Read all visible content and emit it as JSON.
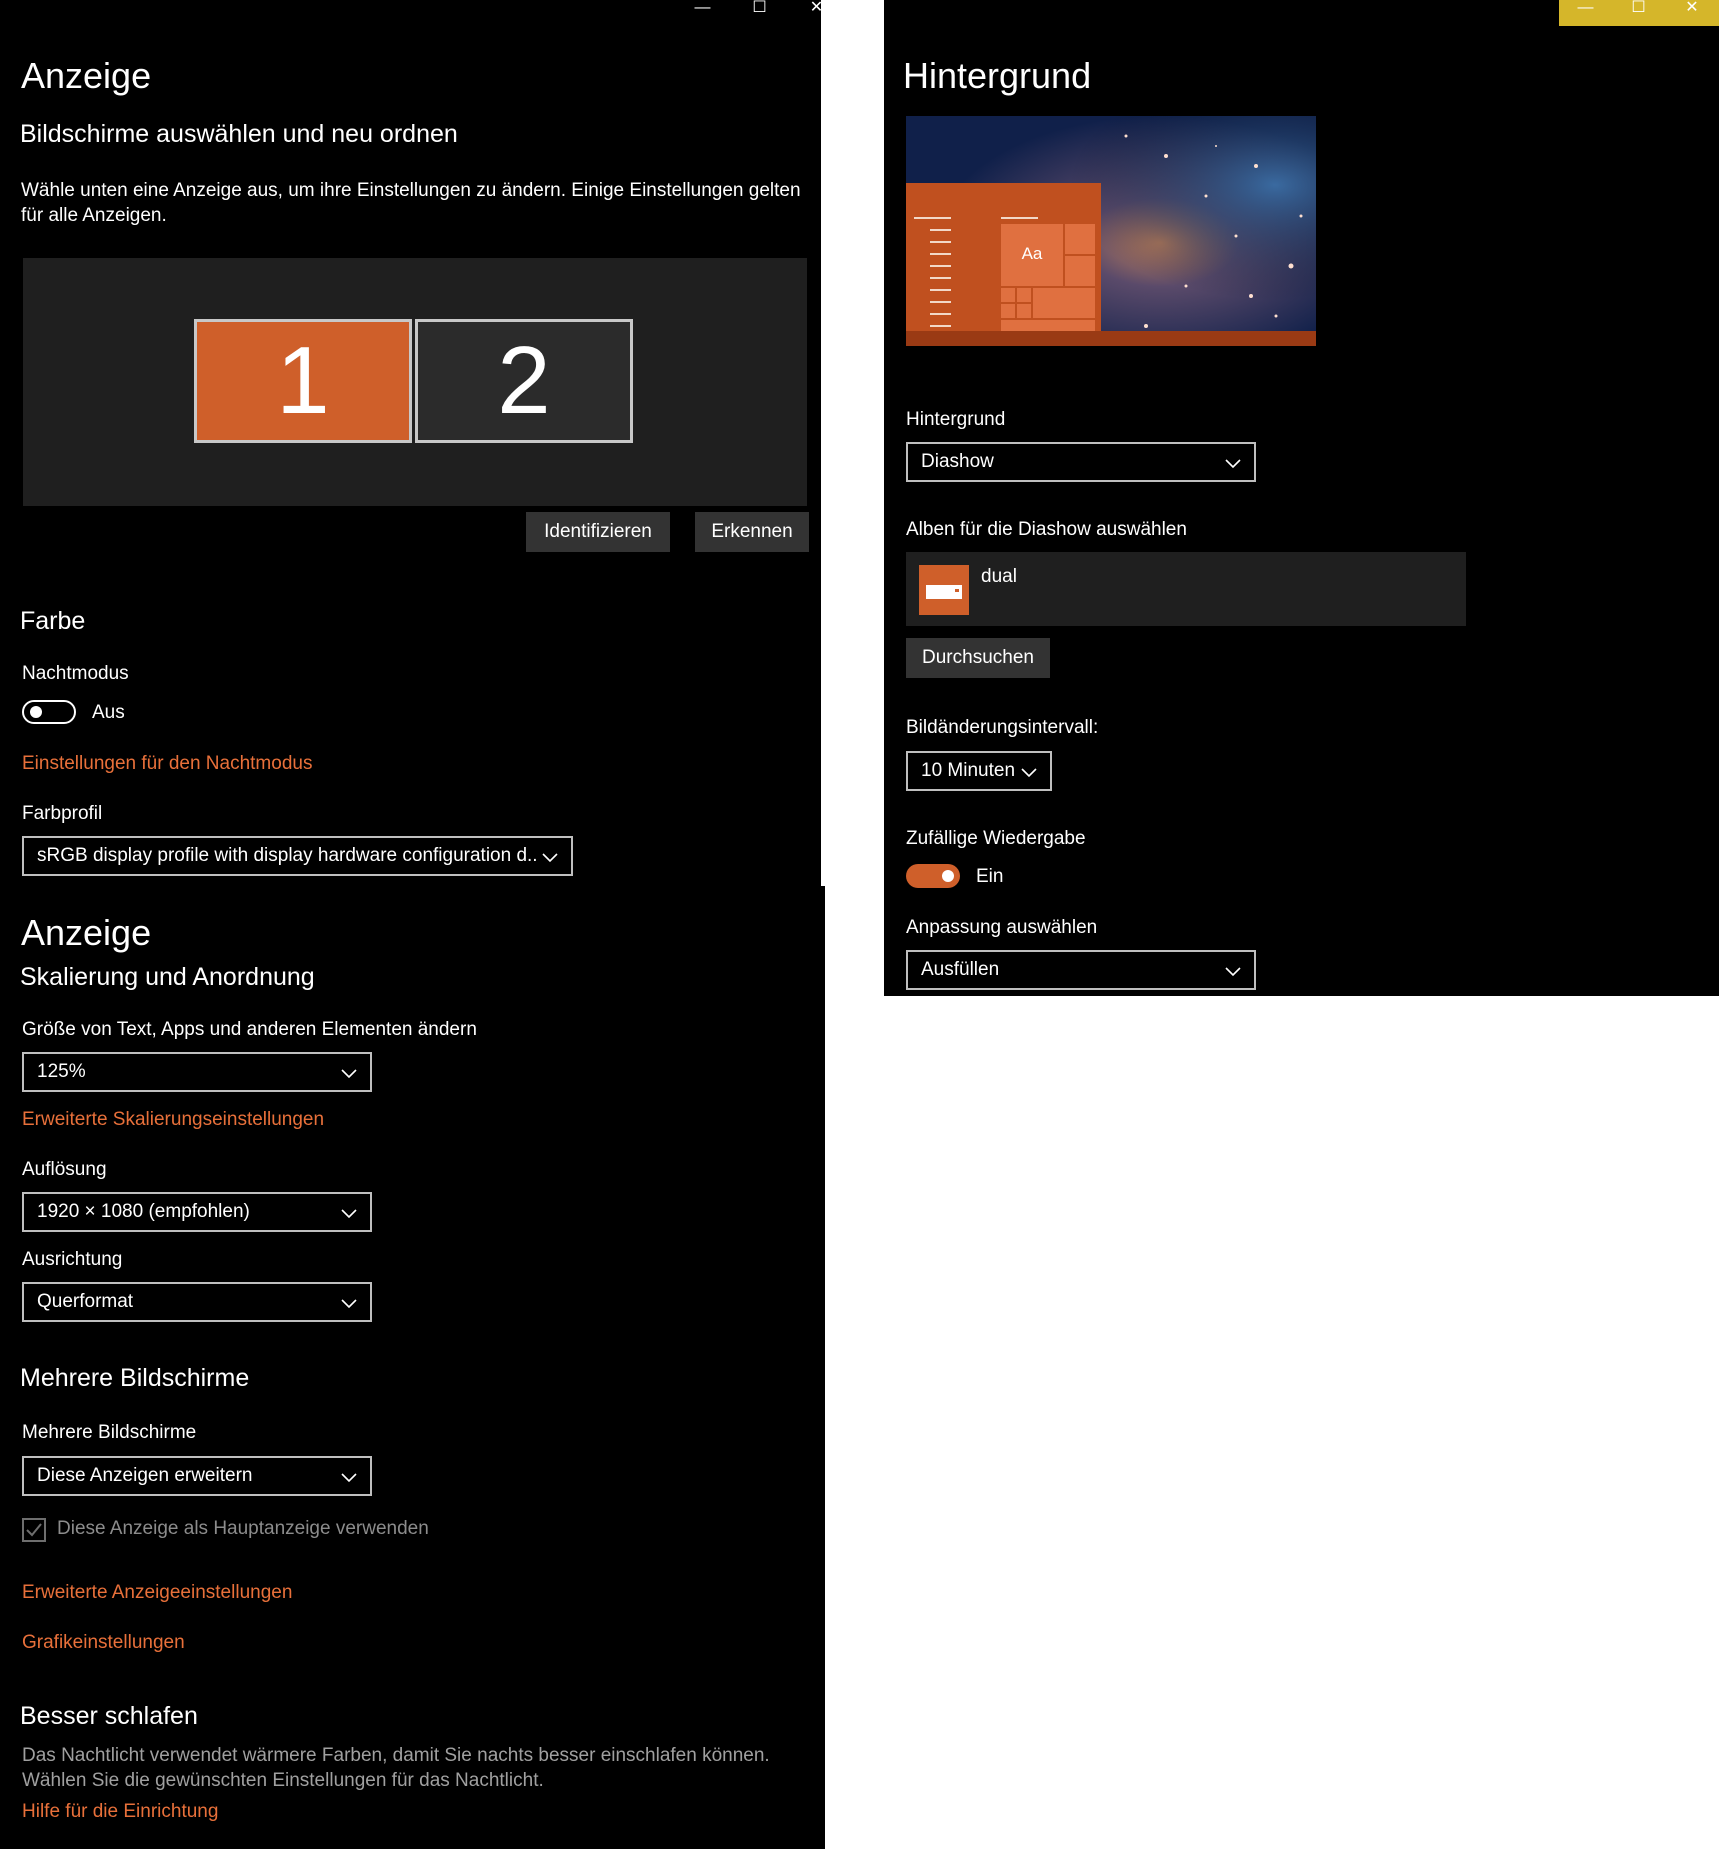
{
  "left_window": {
    "caption": {
      "minimize": "—",
      "maximize": "☐",
      "close": "✕"
    },
    "title": "Anzeige",
    "arrange": {
      "heading": "Bildschirme auswählen und neu ordnen",
      "description": "Wähle unten eine Anzeige aus, um ihre Einstellungen zu ändern. Einige Einstellungen gelten für alle Anzeigen.",
      "monitors": [
        {
          "label": "1",
          "selected": true
        },
        {
          "label": "2",
          "selected": false
        }
      ],
      "identify_label": "Identifizieren",
      "detect_label": "Erkennen"
    },
    "color": {
      "heading": "Farbe",
      "night_mode_label": "Nachtmodus",
      "night_mode_state": "Aus",
      "night_mode_settings_link": "Einstellungen für den Nachtmodus",
      "color_profile_label": "Farbprofil",
      "color_profile_value": "sRGB display profile with display hardware configuration d..."
    },
    "scale": {
      "title": "Anzeige",
      "heading": "Skalierung und Anordnung",
      "size_label": "Größe von Text, Apps und anderen Elementen ändern",
      "size_value": "125%",
      "advanced_scaling_link": "Erweiterte Skalierungseinstellungen",
      "resolution_label": "Auflösung",
      "resolution_value": "1920 × 1080 (empfohlen)",
      "orientation_label": "Ausrichtung",
      "orientation_value": "Querformat"
    },
    "multi": {
      "heading": "Mehrere Bildschirme",
      "label": "Mehrere Bildschirme",
      "value": "Diese Anzeigen erweitern",
      "main_display_checkbox": "Diese Anzeige als Hauptanzeige verwenden",
      "advanced_display_link": "Erweiterte Anzeigeeinstellungen",
      "graphics_link": "Grafikeinstellungen"
    },
    "sleep": {
      "heading": "Besser schlafen",
      "text": "Das Nachtlicht verwendet wärmere Farben, damit Sie nachts besser einschlafen können. Wählen Sie die gewünschten Einstellungen für das Nachtlicht.",
      "help_link": "Hilfe für die Einrichtung"
    }
  },
  "right_window": {
    "caption": {
      "minimize": "—",
      "maximize": "☐",
      "close": "✕"
    },
    "caption_color": "#d5b62a",
    "title": "Hintergrund",
    "preview_tile_text": "Aa",
    "background_label": "Hintergrund",
    "background_value": "Diashow",
    "albums_label": "Alben für die Diashow auswählen",
    "album_name": "dual",
    "browse_label": "Durchsuchen",
    "interval_label": "Bildänderungsintervall:",
    "interval_value": "10 Minuten",
    "shuffle_label": "Zufällige Wiedergabe",
    "shuffle_state": "Ein",
    "fit_label": "Anpassung auswählen",
    "fit_value": "Ausfüllen"
  },
  "colors": {
    "accent": "#cf5f2a",
    "link": "#e8703a",
    "panel": "#1f1f1f"
  }
}
